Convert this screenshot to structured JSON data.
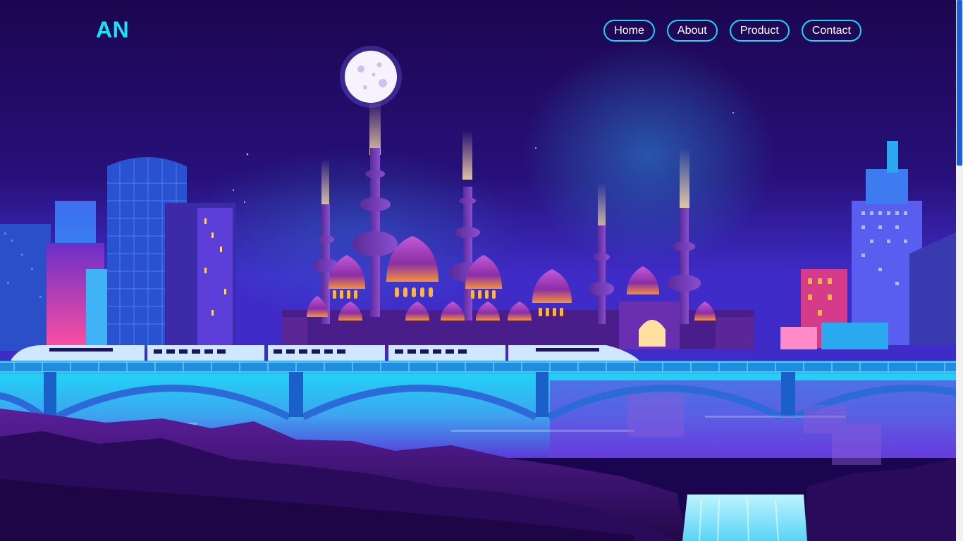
{
  "brand": {
    "logo_text": "AN",
    "accent_color": "#17e3f5"
  },
  "nav": {
    "items": [
      {
        "label": "Home"
      },
      {
        "label": "About"
      },
      {
        "label": "Product"
      },
      {
        "label": "Contact"
      }
    ]
  },
  "scene": {
    "description_icon": "night-city-illustration",
    "palette": {
      "sky_top": "#1d0752",
      "sky_bottom": "#3a1fb0",
      "water": "#1fc6f0",
      "rocks": "#3a0f6e",
      "moon": "#f4f1ff"
    }
  },
  "scrollbar": {
    "thumb_color": "#1b5fdc"
  }
}
